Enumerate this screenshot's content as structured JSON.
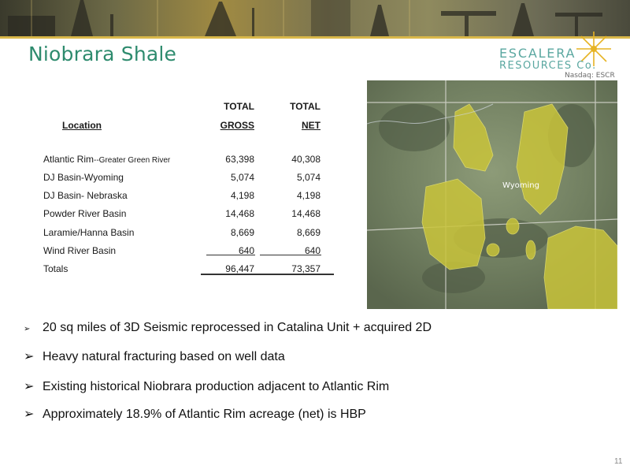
{
  "header": {
    "title": "Niobrara Shale"
  },
  "logo": {
    "line1": "ESCALERA",
    "line2": "RESOURCES Co.",
    "ticker": "Nasdaq: ESCR"
  },
  "table": {
    "header_top": {
      "gross": "TOTAL",
      "net": "TOTAL"
    },
    "header_bottom": {
      "location": "Location",
      "gross": "GROSS",
      "net": "NET"
    },
    "rows": [
      {
        "location": "Atlantic Rim",
        "sub": "--Greater Green River",
        "gross": "63,398",
        "net": "40,308"
      },
      {
        "location": "DJ Basin-Wyoming",
        "sub": "",
        "gross": "5,074",
        "net": "5,074"
      },
      {
        "location": "DJ Basin- Nebraska",
        "sub": "",
        "gross": "4,198",
        "net": "4,198"
      },
      {
        "location": "Powder River Basin",
        "sub": "",
        "gross": "14,468",
        "net": "14,468"
      },
      {
        "location": "Laramie/Hanna Basin",
        "sub": "",
        "gross": "8,669",
        "net": "8,669"
      },
      {
        "location": "Wind River Basin",
        "sub": "",
        "gross": "640",
        "net": "640"
      }
    ],
    "totals": {
      "label": "Totals",
      "gross": "96,447",
      "net": "73,357"
    }
  },
  "map": {
    "label": "Wyoming",
    "colors": {
      "terrain": "#7b8a6a",
      "acreage": "#c9c43a"
    }
  },
  "bullets": [
    "20 sq miles of 3D Seismic reprocessed in Catalina Unit + acquired 2D",
    "Heavy natural fracturing based on well data",
    "Existing historical Niobrara production adjacent to Atlantic Rim",
    "Approximately 18.9% of Atlantic Rim acreage (net) is HBP"
  ],
  "page_number": "11"
}
